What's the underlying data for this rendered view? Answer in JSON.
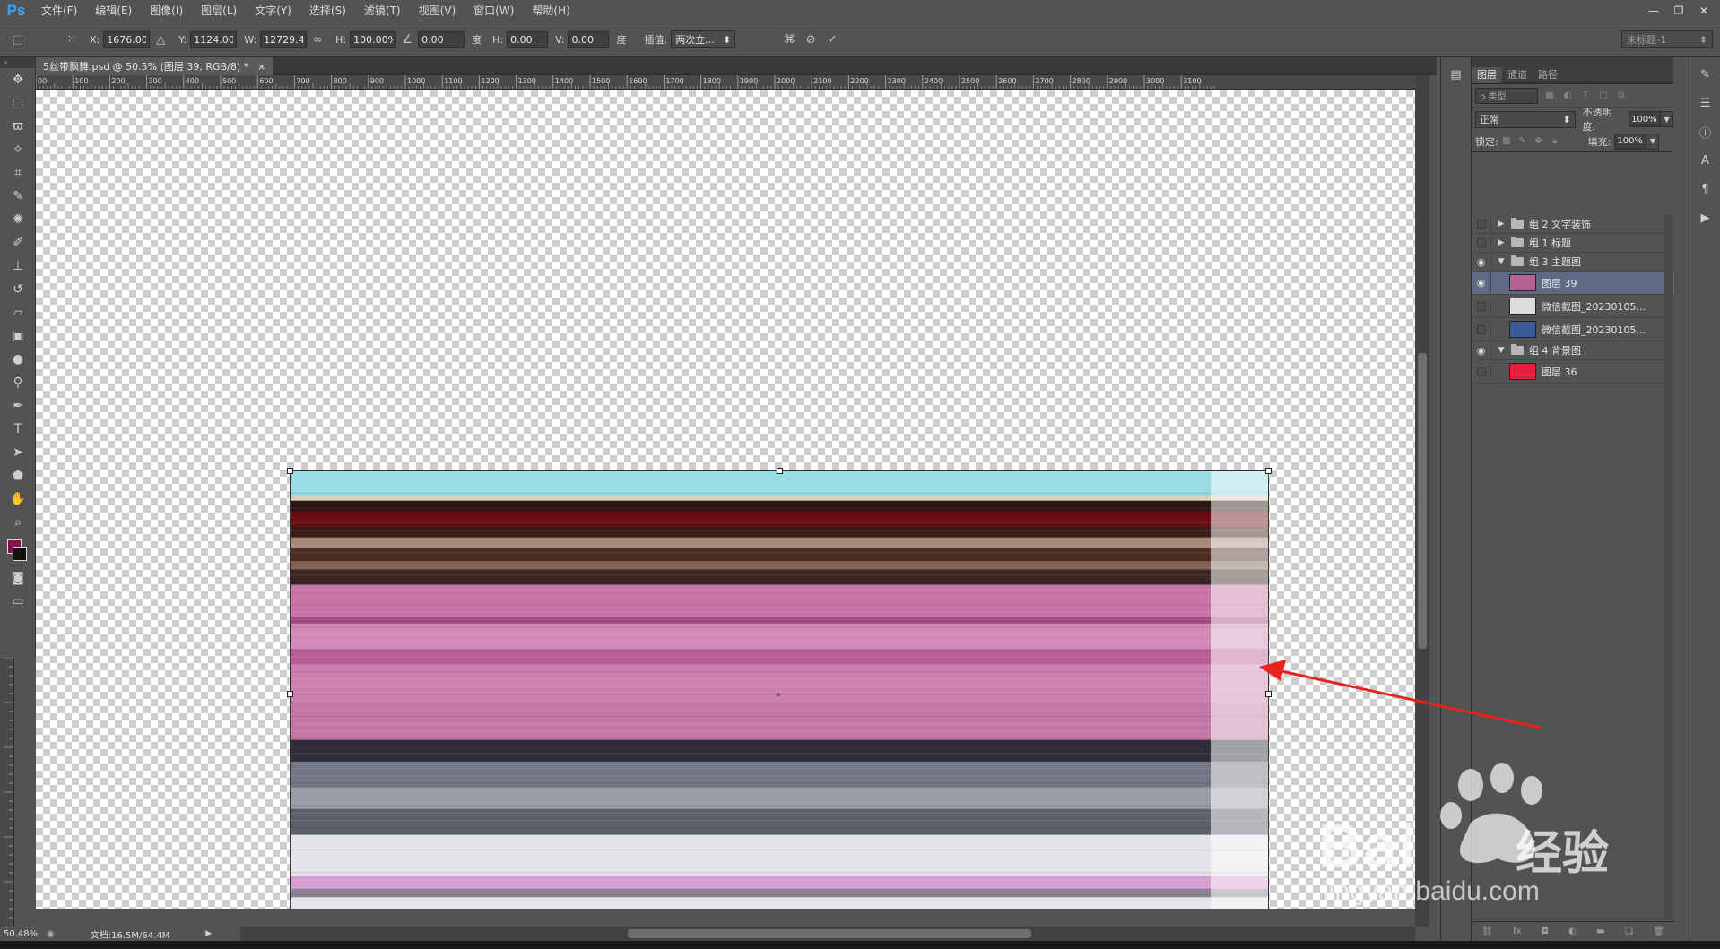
{
  "app": {
    "logo": "Ps",
    "menu": [
      "文件(F)",
      "编辑(E)",
      "图像(I)",
      "图层(L)",
      "文字(Y)",
      "选择(S)",
      "滤镜(T)",
      "视图(V)",
      "窗口(W)",
      "帮助(H)"
    ],
    "window_controls": [
      "—",
      "❐",
      "✕"
    ]
  },
  "options": {
    "x_label": "X:",
    "x_value": "1676.00 像",
    "y_label": "Y:",
    "y_value": "1124.00 像",
    "w_label": "W:",
    "w_value": "12729.41",
    "h_label": "H:",
    "h_value": "100.00%",
    "angle_value": "0.00",
    "angle_unit": "度",
    "hskew_label": "H:",
    "hskew_value": "0.00",
    "hskew_unit": "度",
    "vskew_label": "V:",
    "vskew_value": "0.00",
    "vskew_unit": "度",
    "interp_label": "插值:",
    "interp_value": "两次立...",
    "workspace": "未标题-1"
  },
  "document": {
    "tab_title": "5丝带飘舞.psd @ 50.5% (图层 39, RGB/8) *",
    "tab_close": "×",
    "ruler_ticks": [
      "00",
      "100",
      "200",
      "300",
      "400",
      "500",
      "600",
      "700",
      "800",
      "900",
      "1000",
      "1100",
      "1200",
      "1300",
      "1400",
      "1500",
      "1600",
      "1700",
      "1800",
      "1900",
      "2000",
      "2100",
      "2200",
      "2300",
      "2400",
      "2500",
      "2600",
      "2700",
      "2800",
      "2900",
      "3000",
      "3100"
    ]
  },
  "layer_stripes": [
    {
      "color": "#99dce3",
      "h": 24
    },
    {
      "color": "#d8cdb8",
      "h": 4
    },
    {
      "color": "#2b1612",
      "h": 10
    },
    {
      "color": "#6a0e12",
      "h": 14
    },
    {
      "color": "#3a1c19",
      "h": 10
    },
    {
      "color": "#a8887a",
      "h": 10
    },
    {
      "color": "#4c2d24",
      "h": 12
    },
    {
      "color": "#805e50",
      "h": 8
    },
    {
      "color": "#3a2721",
      "h": 14
    },
    {
      "color": "#c974a6",
      "h": 30
    },
    {
      "color": "#a1487f",
      "h": 6
    },
    {
      "color": "#d08ab6",
      "h": 24
    },
    {
      "color": "#b85c95",
      "h": 14
    },
    {
      "color": "#cd80b0",
      "h": 34
    },
    {
      "color": "#c477a6",
      "h": 36
    },
    {
      "color": "#2f2d3a",
      "h": 20
    },
    {
      "color": "#737684",
      "h": 24
    },
    {
      "color": "#9a9ca8",
      "h": 20
    },
    {
      "color": "#5d5f6b",
      "h": 24
    },
    {
      "color": "#e3e4e8",
      "h": 38
    },
    {
      "color": "#d49fd0",
      "h": 12
    },
    {
      "color": "#8c8692",
      "h": 8
    },
    {
      "color": "#e3e4e8",
      "h": 18
    }
  ],
  "status": {
    "zoom": "50.48%",
    "doc_size": "文档:16.5M/64.4M"
  },
  "layers_panel": {
    "tabs": [
      "图层",
      "通道",
      "路径"
    ],
    "filter_kind": "ρ 类型",
    "blend_mode": "正常",
    "opacity_label": "不透明度:",
    "opacity_value": "100%",
    "lock_label": "锁定:",
    "fill_label": "填充:",
    "fill_value": "100%",
    "layers": [
      {
        "name": "组 2 文字装饰",
        "type": "group",
        "visible": false,
        "open": false,
        "thumb": ""
      },
      {
        "name": "组 1 标题",
        "type": "group",
        "visible": false,
        "open": false,
        "thumb": ""
      },
      {
        "name": "组 3 主题图",
        "type": "group",
        "visible": true,
        "open": true,
        "thumb": ""
      },
      {
        "name": "图层 39",
        "type": "layer",
        "visible": true,
        "selected": true,
        "thumb": "#b86294"
      },
      {
        "name": "微信截图_20230105...",
        "type": "layer",
        "visible": false,
        "thumb": "#dcdcdc"
      },
      {
        "name": "微信截图_20230105...",
        "type": "layer",
        "visible": false,
        "thumb": "#3a5a9a"
      },
      {
        "name": "组 4 背景图",
        "type": "group",
        "visible": true,
        "open": true,
        "thumb": ""
      },
      {
        "name": "图层 36",
        "type": "layer",
        "visible": false,
        "thumb": "#e81e3c"
      }
    ],
    "footer_icons": [
      "link-icon",
      "fx-icon",
      "mask-icon",
      "adjustment-icon",
      "group-icon",
      "new-layer-icon",
      "trash-icon"
    ]
  },
  "watermark": {
    "brand": "Bai",
    "brand2": "经验",
    "url": "jingyan.baidu.com"
  }
}
